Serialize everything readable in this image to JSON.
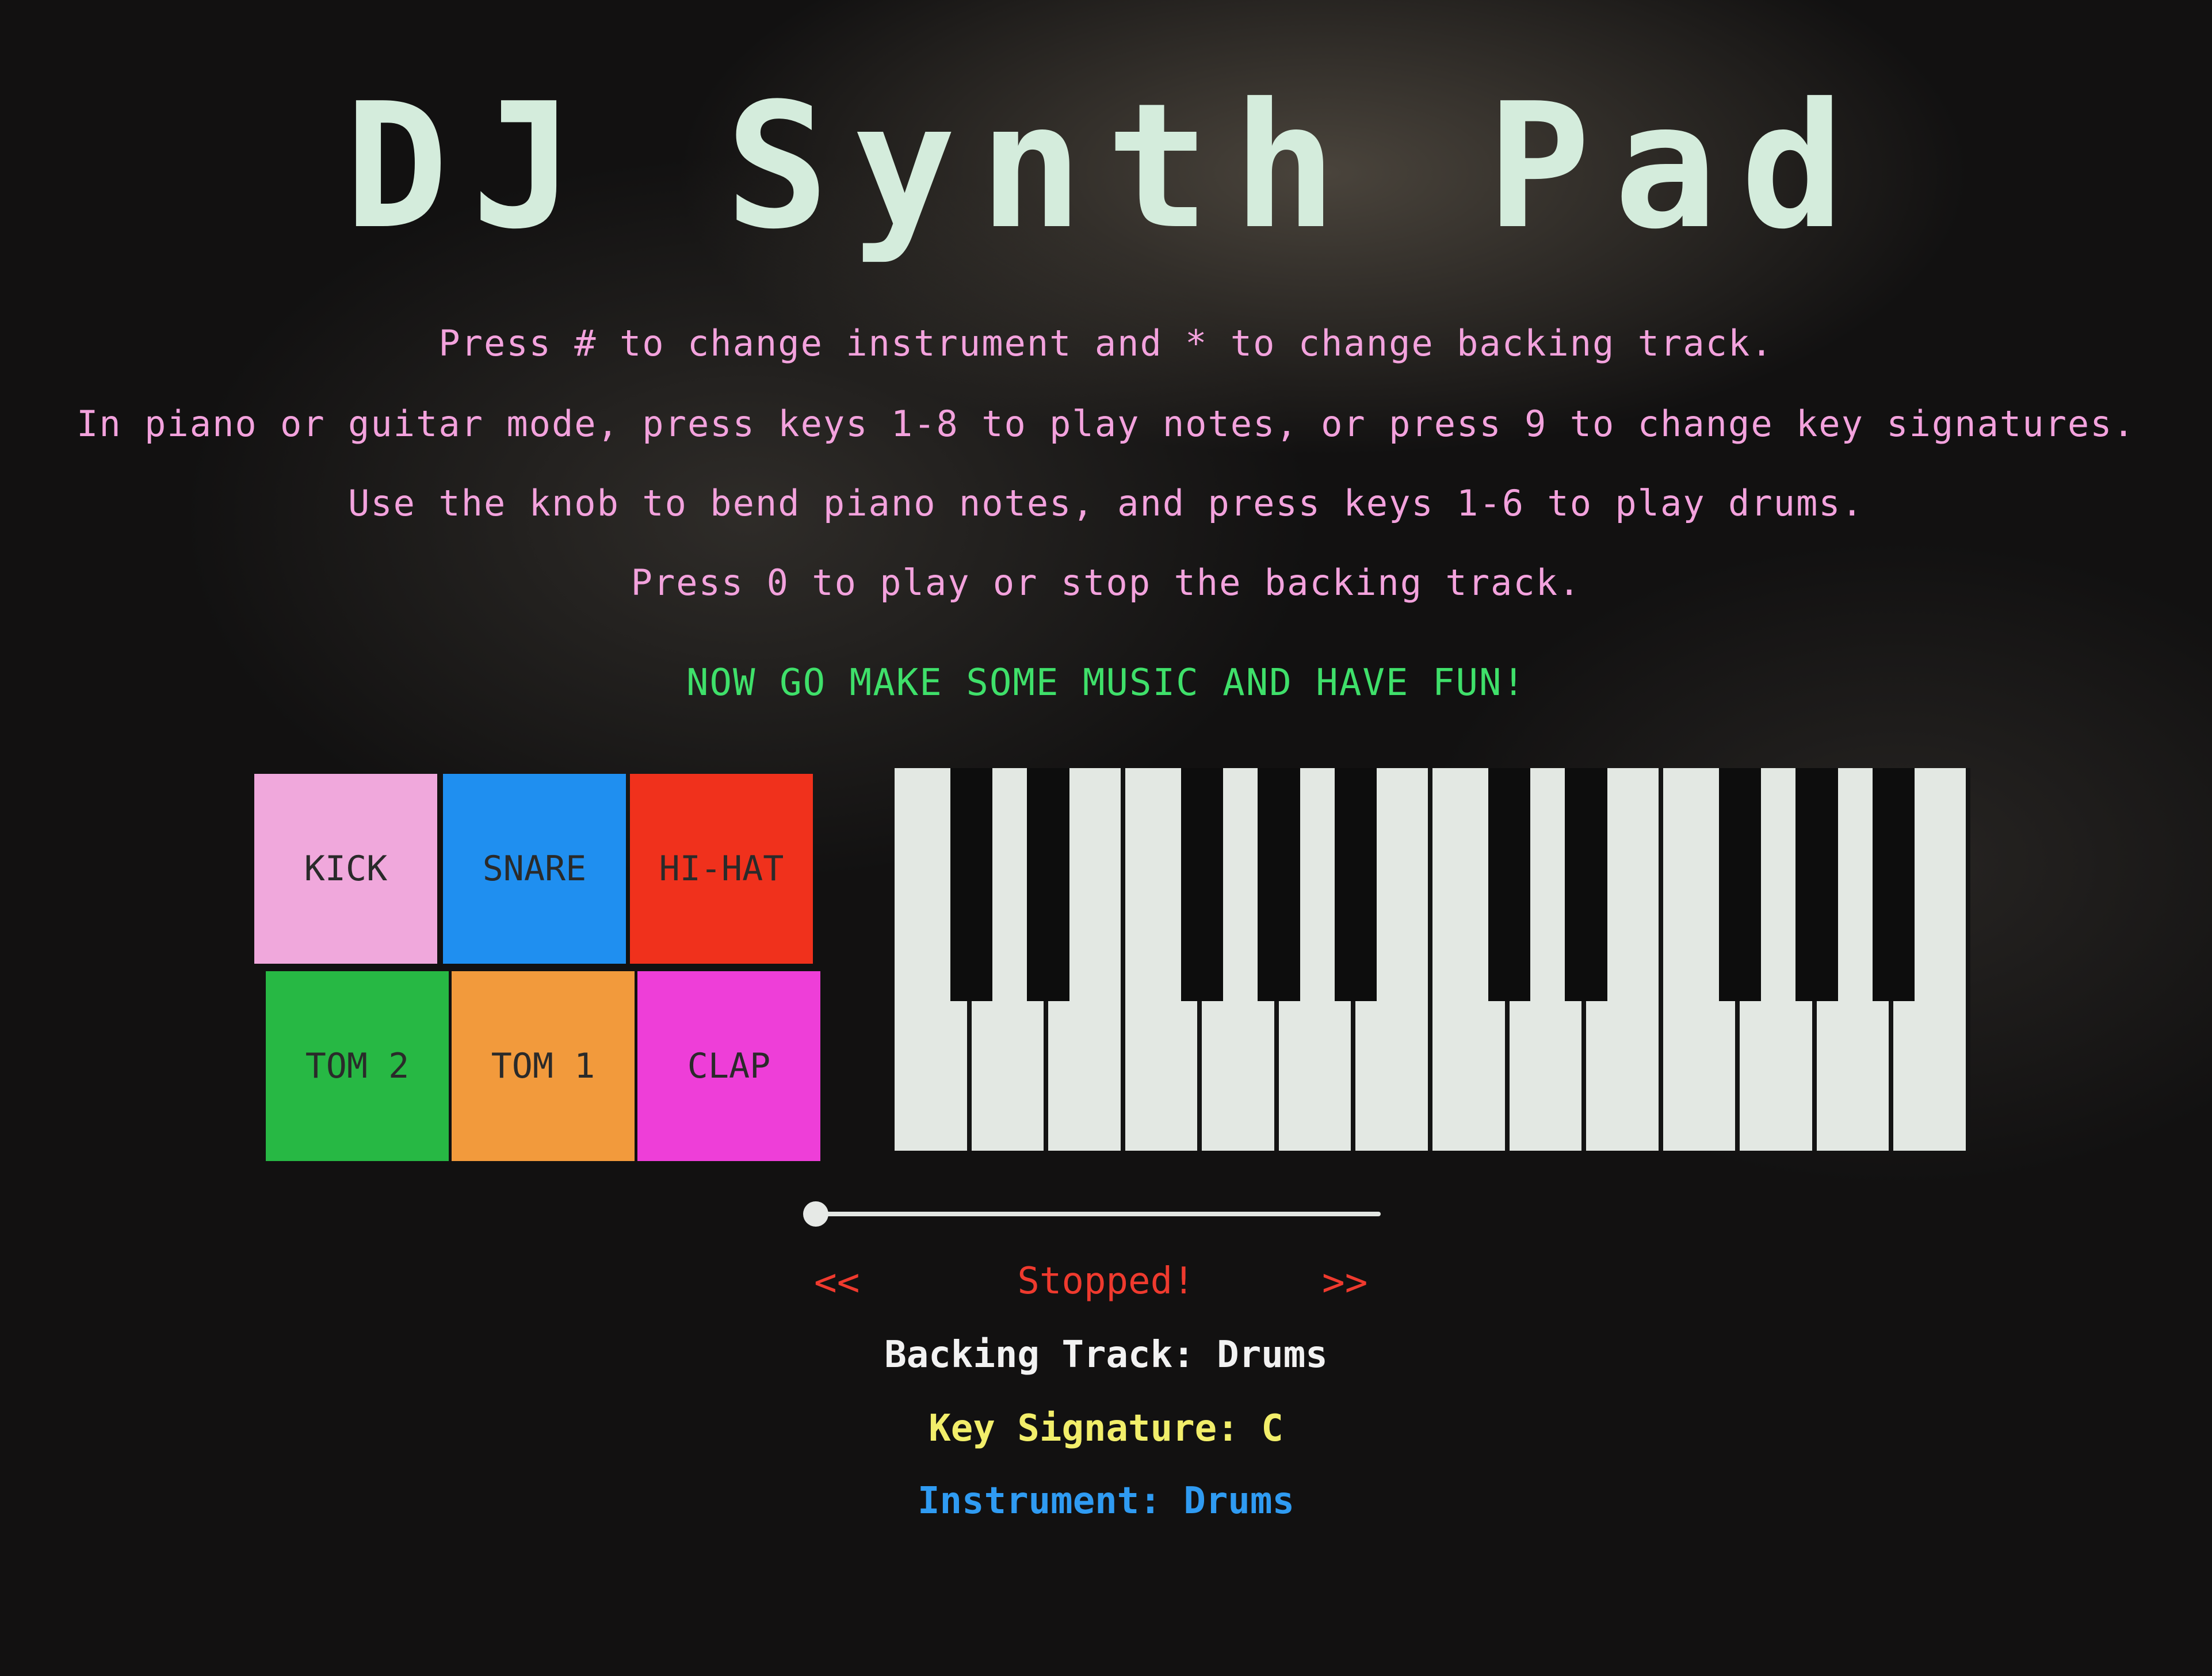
{
  "app": {
    "title": "DJ Synth Pad"
  },
  "instructions": [
    "Press # to change instrument and * to change backing track.",
    "In piano or guitar mode, press keys 1-8 to play notes, or press 9 to change key signatures.",
    "Use the knob to bend piano notes, and press keys 1-6 to play drums.",
    "Press 0 to play or stop the backing track."
  ],
  "tagline": "NOW GO MAKE SOME MUSIC AND HAVE FUN!",
  "drum_pads": [
    {
      "label": "KICK",
      "color": "#f0a8dc"
    },
    {
      "label": "SNARE",
      "color": "#1f8ff0"
    },
    {
      "label": "HI-HAT",
      "color": "#f0311c"
    },
    {
      "label": "TOM 2",
      "color": "#27b844"
    },
    {
      "label": "TOM 1",
      "color": "#f29a3c"
    },
    {
      "label": "CLAP",
      "color": "#ee3ed8"
    }
  ],
  "keyboard": {
    "white_key_count": 14,
    "black_key_count": 10,
    "white_key_color": "#e3e8e3",
    "black_key_color": "#0d0d0d"
  },
  "pitch_slider": {
    "value": 0
  },
  "transport": {
    "prev_label": "<<",
    "next_label": ">>",
    "status": "Stopped!",
    "status_color": "#ef3a2e"
  },
  "info": {
    "backing_track": "Backing Track: Drums",
    "key_signature": "Key Signature: C",
    "instrument": "Instrument: Drums"
  },
  "colors": {
    "title": "#d4ecdc",
    "instructions": "#f3a2dd",
    "tagline": "#3fe06a",
    "backing_track": "#f2f2f2",
    "key_signature": "#f2ee6a",
    "instrument": "#2f9bf2"
  }
}
